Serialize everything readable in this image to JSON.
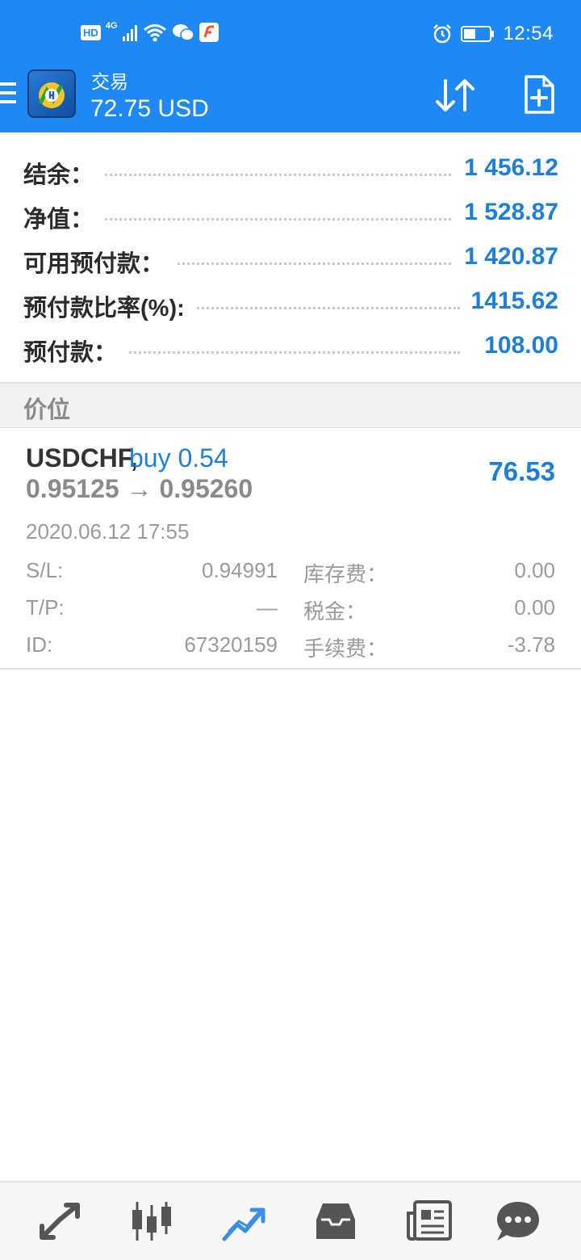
{
  "status_bar": {
    "hd_badge": "HD",
    "network": "4G",
    "time": "12:54"
  },
  "app_bar": {
    "title": "交易",
    "subtitle": "72.75 USD",
    "icons": [
      "menu-icon",
      "metatrader-logo",
      "sort-icon",
      "new-order-icon"
    ]
  },
  "summary": [
    {
      "label": "结余：",
      "value": "1 456.12"
    },
    {
      "label": "净值：",
      "value": "1 528.87"
    },
    {
      "label": "可用预付款：",
      "value": "1 420.87"
    },
    {
      "label": "预付款比率(%):",
      "value": "1415.62"
    },
    {
      "label": "预付款：",
      "value": "108.00"
    }
  ],
  "section": {
    "title": "价位"
  },
  "position": {
    "symbol": "USDCHF,",
    "type": "buy 0.54",
    "prices": "0.95125 → 0.95260",
    "profit": "76.53",
    "time": "2020.06.12 17:55",
    "details": {
      "sl_label": "S/L:",
      "sl_value": "0.94991",
      "tp_label": "T/P:",
      "tp_value": "—",
      "id_label": "ID:",
      "id_value": "67320159",
      "swap_label": "库存费：",
      "swap_value": "0.00",
      "tax_label": "税金：",
      "tax_value": "0.00",
      "commission_label": "手续费：",
      "commission_value": "-3.78"
    }
  },
  "bottom_nav": [
    "quotes-icon",
    "chart-icon",
    "trade-icon",
    "history-icon",
    "news-icon",
    "messages-icon"
  ],
  "colors": {
    "accent": "#1e88f5",
    "value_blue": "#1e7fd9"
  }
}
